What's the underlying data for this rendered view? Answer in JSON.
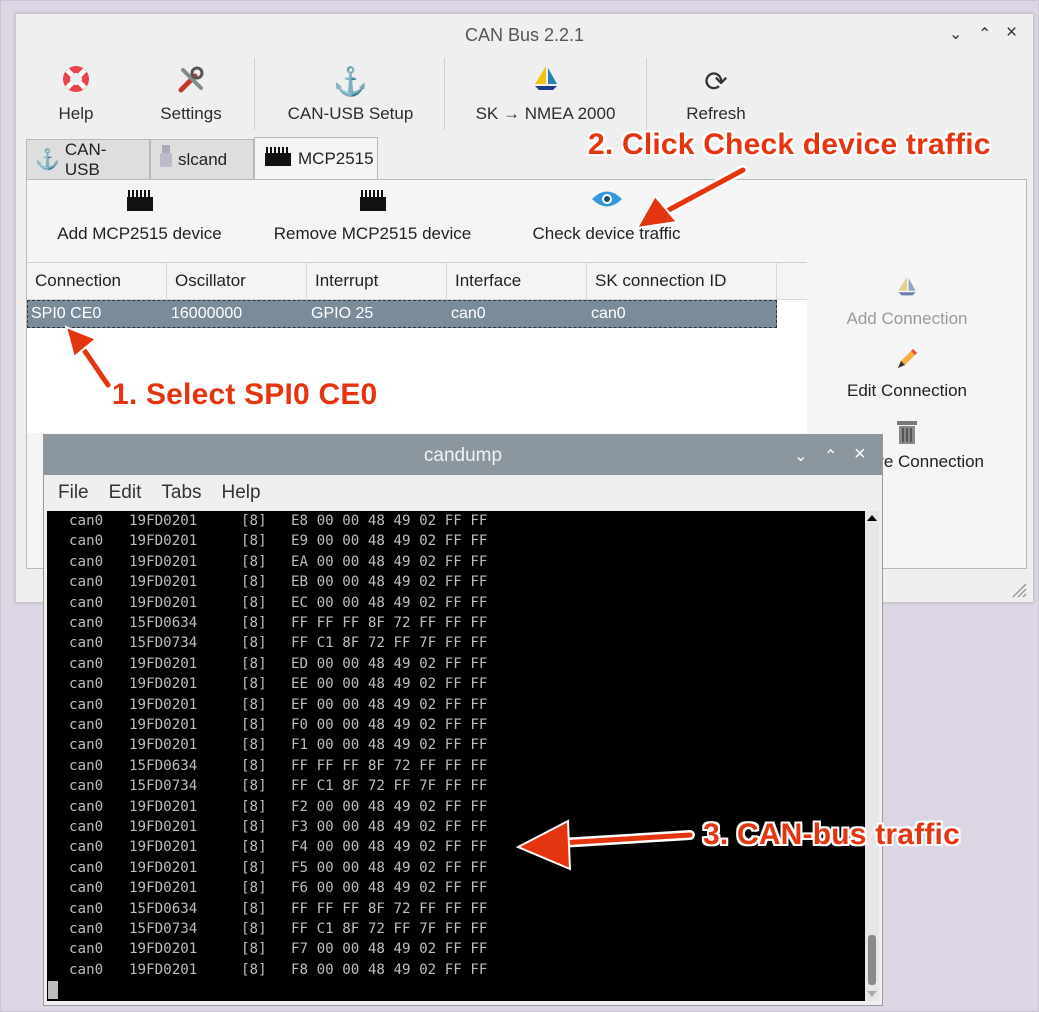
{
  "main_window": {
    "title": "CAN Bus 2.2.1",
    "controls": {
      "minimize": "⌄",
      "maximize": "⌃",
      "close": "×"
    },
    "toolbar": {
      "help": "Help",
      "settings": "Settings",
      "can_usb_setup": "CAN-USB Setup",
      "sk_nmea": "SK → NMEA 2000",
      "refresh": "Refresh"
    },
    "tabs": {
      "can_usb": "CAN-USB",
      "slcand": "slcand",
      "mcp2515": "MCP2515"
    },
    "actions": {
      "add": "Add MCP2515 device",
      "remove": "Remove MCP2515 device",
      "check": "Check device traffic"
    },
    "table": {
      "headers": [
        "Connection",
        "Oscillator",
        "Interrupt",
        "Interface",
        "SK connection ID"
      ],
      "row": [
        "SPI0 CE0",
        "16000000",
        "GPIO 25",
        "can0",
        "can0"
      ]
    },
    "side": {
      "add_connection": "Add Connection",
      "edit_connection": "Edit Connection",
      "remove_connection": "Remove Connection"
    }
  },
  "terminal": {
    "title": "candump",
    "menu": {
      "file": "File",
      "edit": "Edit",
      "tabs": "Tabs",
      "help": "Help"
    },
    "lines": [
      [
        "can0",
        "19FD0201",
        "[8]",
        "E8 00 00 48 49 02 FF FF"
      ],
      [
        "can0",
        "19FD0201",
        "[8]",
        "E9 00 00 48 49 02 FF FF"
      ],
      [
        "can0",
        "19FD0201",
        "[8]",
        "EA 00 00 48 49 02 FF FF"
      ],
      [
        "can0",
        "19FD0201",
        "[8]",
        "EB 00 00 48 49 02 FF FF"
      ],
      [
        "can0",
        "19FD0201",
        "[8]",
        "EC 00 00 48 49 02 FF FF"
      ],
      [
        "can0",
        "15FD0634",
        "[8]",
        "FF FF FF 8F 72 FF FF FF"
      ],
      [
        "can0",
        "15FD0734",
        "[8]",
        "FF C1 8F 72 FF 7F FF FF"
      ],
      [
        "can0",
        "19FD0201",
        "[8]",
        "ED 00 00 48 49 02 FF FF"
      ],
      [
        "can0",
        "19FD0201",
        "[8]",
        "EE 00 00 48 49 02 FF FF"
      ],
      [
        "can0",
        "19FD0201",
        "[8]",
        "EF 00 00 48 49 02 FF FF"
      ],
      [
        "can0",
        "19FD0201",
        "[8]",
        "F0 00 00 48 49 02 FF FF"
      ],
      [
        "can0",
        "19FD0201",
        "[8]",
        "F1 00 00 48 49 02 FF FF"
      ],
      [
        "can0",
        "15FD0634",
        "[8]",
        "FF FF FF 8F 72 FF FF FF"
      ],
      [
        "can0",
        "15FD0734",
        "[8]",
        "FF C1 8F 72 FF 7F FF FF"
      ],
      [
        "can0",
        "19FD0201",
        "[8]",
        "F2 00 00 48 49 02 FF FF"
      ],
      [
        "can0",
        "19FD0201",
        "[8]",
        "F3 00 00 48 49 02 FF FF"
      ],
      [
        "can0",
        "19FD0201",
        "[8]",
        "F4 00 00 48 49 02 FF FF"
      ],
      [
        "can0",
        "19FD0201",
        "[8]",
        "F5 00 00 48 49 02 FF FF"
      ],
      [
        "can0",
        "19FD0201",
        "[8]",
        "F6 00 00 48 49 02 FF FF"
      ],
      [
        "can0",
        "15FD0634",
        "[8]",
        "FF FF FF 8F 72 FF FF FF"
      ],
      [
        "can0",
        "15FD0734",
        "[8]",
        "FF C1 8F 72 FF 7F FF FF"
      ],
      [
        "can0",
        "19FD0201",
        "[8]",
        "F7 00 00 48 49 02 FF FF"
      ],
      [
        "can0",
        "19FD0201",
        "[8]",
        "F8 00 00 48 49 02 FF FF"
      ]
    ]
  },
  "annotations": {
    "step1": "1. Select SPI0 CE0",
    "step2": "2. Click Check device traffic",
    "step3": "3. CAN-bus traffic"
  },
  "colors": {
    "accent": "#e53410",
    "selection": "#7a8b9a",
    "terminal_bg": "#000000",
    "terminal_fg": "#bdbdbd"
  }
}
